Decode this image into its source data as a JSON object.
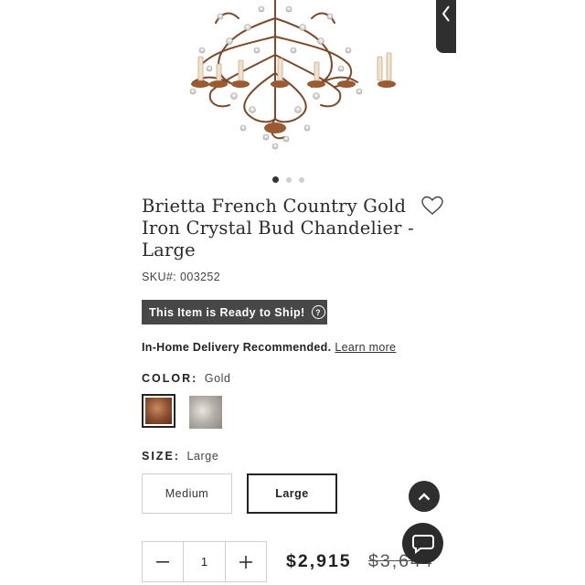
{
  "product": {
    "title": "Brietta French Country Gold Iron Crystal Bud Chandelier - Large",
    "sku": "SKU#: 003252",
    "ready_badge": "This Item is Ready to Ship!",
    "ready_help": "?",
    "delivery_text": "In-Home Delivery Recommended.",
    "learn_more": "Learn more",
    "color_label": "COLOR:",
    "color_value": "Gold",
    "size_label": "SIZE:",
    "size_value": "Large",
    "sizes": [
      "Medium",
      "Large"
    ],
    "quantity": "1",
    "price": "$2,915",
    "old_price": "$3,644"
  },
  "carousel": {
    "total": 3,
    "active": 1
  },
  "colors": {
    "dark": "#2f2f2f",
    "badge": "#474747",
    "border": "#cfcfcf"
  },
  "icons": [
    "chevron-left-icon",
    "heart-icon",
    "help-icon",
    "minus-icon",
    "plus-icon",
    "chevron-up-icon",
    "chat-icon"
  ]
}
